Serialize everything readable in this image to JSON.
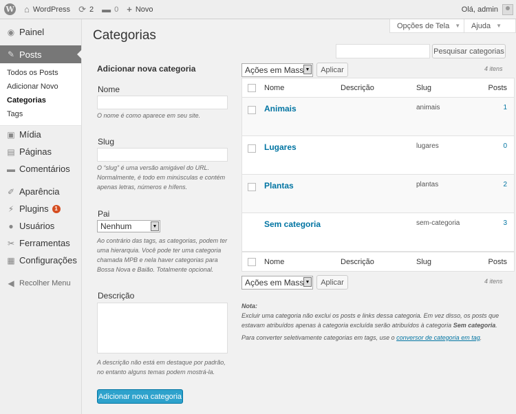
{
  "adminbar": {
    "site_name": "WordPress",
    "updates_count": "2",
    "comments_count": "0",
    "new_label": "Novo",
    "greeting": "Olá, admin"
  },
  "sidebar": {
    "items": [
      {
        "label": "Painel",
        "icon": "dashboard-icon"
      },
      {
        "label": "Posts",
        "icon": "pin-icon"
      },
      {
        "label": "Mídia",
        "icon": "media-icon"
      },
      {
        "label": "Páginas",
        "icon": "pages-icon"
      },
      {
        "label": "Comentários",
        "icon": "comments-icon"
      },
      {
        "label": "Aparência",
        "icon": "appearance-icon"
      },
      {
        "label": "Plugins",
        "icon": "plugins-icon",
        "badge": "1"
      },
      {
        "label": "Usuários",
        "icon": "users-icon"
      },
      {
        "label": "Ferramentas",
        "icon": "tools-icon"
      },
      {
        "label": "Configurações",
        "icon": "settings-icon"
      }
    ],
    "submenu": [
      "Todos os Posts",
      "Adicionar Novo",
      "Categorias",
      "Tags"
    ],
    "collapse_label": "Recolher Menu"
  },
  "header": {
    "title": "Categorias",
    "screen_options": "Opções de Tela",
    "help": "Ajuda",
    "search_button": "Pesquisar categorias",
    "search_value": ""
  },
  "form": {
    "title": "Adicionar nova categoria",
    "name_label": "Nome",
    "name_value": "",
    "name_desc": "O nome é como aparece em seu site.",
    "slug_label": "Slug",
    "slug_value": "",
    "slug_desc": "O “slug” é uma versão amigável do URL. Normalmente, é todo em minúsculas e contém apenas letras, números e hífens.",
    "parent_label": "Pai",
    "parent_value": "Nenhum",
    "parent_desc": "Ao contrário das tags, as categorias, podem ter uma hierarquia. Você pode ter uma categoria chamada MPB e nela haver categorias para Bossa Nova e Baião. Totalmente opcional.",
    "description_label": "Descrição",
    "description_value": "",
    "description_desc": "A descrição não está em destaque por padrão, no entanto alguns temas podem mostrá-la.",
    "submit_label": "Adicionar nova categoria"
  },
  "table": {
    "bulk_actions": "Ações em Massa",
    "apply_label": "Aplicar",
    "items_count": "4 itens",
    "columns": [
      "Nome",
      "Descrição",
      "Slug",
      "Posts"
    ],
    "rows": [
      {
        "name": "Animais",
        "description": "",
        "slug": "animais",
        "posts": "1"
      },
      {
        "name": "Lugares",
        "description": "",
        "slug": "lugares",
        "posts": "0"
      },
      {
        "name": "Plantas",
        "description": "",
        "slug": "plantas",
        "posts": "2"
      },
      {
        "name": "Sem categoria",
        "description": "",
        "slug": "sem-categoria",
        "posts": "3"
      }
    ]
  },
  "note": {
    "heading": "Nota:",
    "text1": "Excluir uma categoria não exclui os posts e links dessa categoria. Em vez disso, os posts que estavam atribuídos apenas à categoria excluída serão atribuídos à categoria",
    "text1_bold": "Sem categoria",
    "text1_end": ".",
    "text2": "Para converter seletivamente categorias em tags, use o",
    "link": "conversor de categoria em tag",
    "text2_end": "."
  },
  "colors": {
    "accent": "#0074a2",
    "primary_button": "#2ea2cc",
    "sidebar_current": "#777777",
    "badge": "#d54e21"
  }
}
